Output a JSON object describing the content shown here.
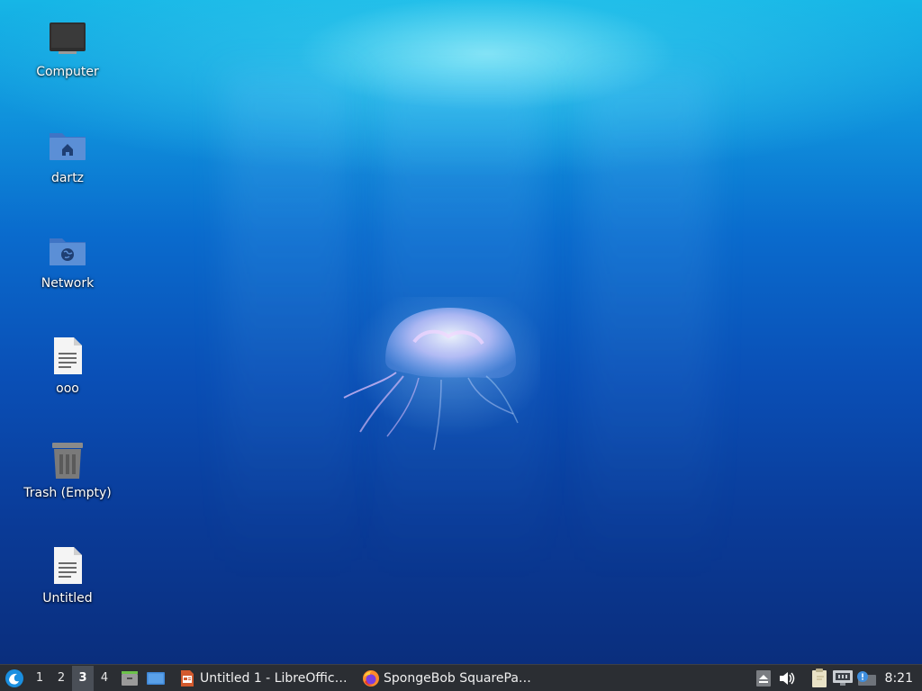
{
  "desktop": {
    "icons": [
      {
        "label": "Computer",
        "icon": "computer-icon"
      },
      {
        "label": "dartz",
        "icon": "home-folder-icon"
      },
      {
        "label": "Network",
        "icon": "network-folder-icon"
      },
      {
        "label": "ooo",
        "icon": "text-file-icon"
      },
      {
        "label": "Trash (Empty)",
        "icon": "trash-icon"
      },
      {
        "label": "Untitled",
        "icon": "text-file-icon"
      }
    ]
  },
  "taskbar": {
    "start_icon": "lubuntu-logo-icon",
    "workspaces": [
      "1",
      "2",
      "3",
      "4"
    ],
    "active_workspace": "3",
    "quicklaunch": [
      {
        "icon": "file-manager-icon"
      },
      {
        "icon": "show-desktop-icon"
      }
    ],
    "tasks": [
      {
        "label": "Untitled 1 - LibreOffic…",
        "icon": "libreoffice-impress-icon"
      },
      {
        "label": "SpongeBob SquarePa…",
        "icon": "firefox-icon"
      }
    ],
    "tray": [
      {
        "icon": "eject-icon"
      },
      {
        "icon": "volume-icon"
      },
      {
        "icon": "clipboard-icon"
      },
      {
        "icon": "network-wired-icon"
      },
      {
        "icon": "update-notifier-icon"
      }
    ],
    "clock": "8:21"
  },
  "colors": {
    "taskbar_bg": "#2b2e33",
    "folder_blue": "#5b8fd6",
    "active_workspace_bg": "#4a4f57"
  }
}
